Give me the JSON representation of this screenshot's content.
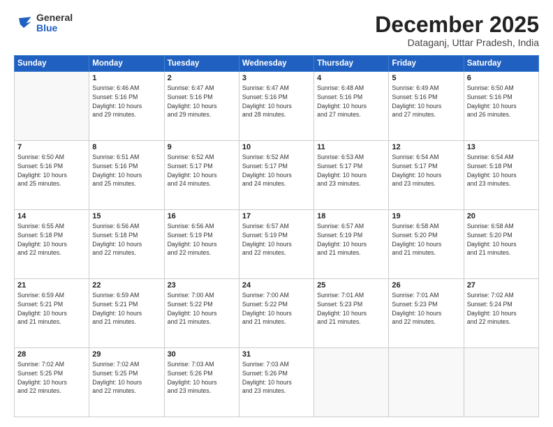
{
  "logo": {
    "general": "General",
    "blue": "Blue"
  },
  "header": {
    "month": "December 2025",
    "location": "Dataganj, Uttar Pradesh, India"
  },
  "weekdays": [
    "Sunday",
    "Monday",
    "Tuesday",
    "Wednesday",
    "Thursday",
    "Friday",
    "Saturday"
  ],
  "weeks": [
    [
      {
        "day": "",
        "info": ""
      },
      {
        "day": "1",
        "info": "Sunrise: 6:46 AM\nSunset: 5:16 PM\nDaylight: 10 hours\nand 29 minutes."
      },
      {
        "day": "2",
        "info": "Sunrise: 6:47 AM\nSunset: 5:16 PM\nDaylight: 10 hours\nand 29 minutes."
      },
      {
        "day": "3",
        "info": "Sunrise: 6:47 AM\nSunset: 5:16 PM\nDaylight: 10 hours\nand 28 minutes."
      },
      {
        "day": "4",
        "info": "Sunrise: 6:48 AM\nSunset: 5:16 PM\nDaylight: 10 hours\nand 27 minutes."
      },
      {
        "day": "5",
        "info": "Sunrise: 6:49 AM\nSunset: 5:16 PM\nDaylight: 10 hours\nand 27 minutes."
      },
      {
        "day": "6",
        "info": "Sunrise: 6:50 AM\nSunset: 5:16 PM\nDaylight: 10 hours\nand 26 minutes."
      }
    ],
    [
      {
        "day": "7",
        "info": "Sunrise: 6:50 AM\nSunset: 5:16 PM\nDaylight: 10 hours\nand 25 minutes."
      },
      {
        "day": "8",
        "info": "Sunrise: 6:51 AM\nSunset: 5:16 PM\nDaylight: 10 hours\nand 25 minutes."
      },
      {
        "day": "9",
        "info": "Sunrise: 6:52 AM\nSunset: 5:17 PM\nDaylight: 10 hours\nand 24 minutes."
      },
      {
        "day": "10",
        "info": "Sunrise: 6:52 AM\nSunset: 5:17 PM\nDaylight: 10 hours\nand 24 minutes."
      },
      {
        "day": "11",
        "info": "Sunrise: 6:53 AM\nSunset: 5:17 PM\nDaylight: 10 hours\nand 23 minutes."
      },
      {
        "day": "12",
        "info": "Sunrise: 6:54 AM\nSunset: 5:17 PM\nDaylight: 10 hours\nand 23 minutes."
      },
      {
        "day": "13",
        "info": "Sunrise: 6:54 AM\nSunset: 5:18 PM\nDaylight: 10 hours\nand 23 minutes."
      }
    ],
    [
      {
        "day": "14",
        "info": "Sunrise: 6:55 AM\nSunset: 5:18 PM\nDaylight: 10 hours\nand 22 minutes."
      },
      {
        "day": "15",
        "info": "Sunrise: 6:56 AM\nSunset: 5:18 PM\nDaylight: 10 hours\nand 22 minutes."
      },
      {
        "day": "16",
        "info": "Sunrise: 6:56 AM\nSunset: 5:19 PM\nDaylight: 10 hours\nand 22 minutes."
      },
      {
        "day": "17",
        "info": "Sunrise: 6:57 AM\nSunset: 5:19 PM\nDaylight: 10 hours\nand 22 minutes."
      },
      {
        "day": "18",
        "info": "Sunrise: 6:57 AM\nSunset: 5:19 PM\nDaylight: 10 hours\nand 21 minutes."
      },
      {
        "day": "19",
        "info": "Sunrise: 6:58 AM\nSunset: 5:20 PM\nDaylight: 10 hours\nand 21 minutes."
      },
      {
        "day": "20",
        "info": "Sunrise: 6:58 AM\nSunset: 5:20 PM\nDaylight: 10 hours\nand 21 minutes."
      }
    ],
    [
      {
        "day": "21",
        "info": "Sunrise: 6:59 AM\nSunset: 5:21 PM\nDaylight: 10 hours\nand 21 minutes."
      },
      {
        "day": "22",
        "info": "Sunrise: 6:59 AM\nSunset: 5:21 PM\nDaylight: 10 hours\nand 21 minutes."
      },
      {
        "day": "23",
        "info": "Sunrise: 7:00 AM\nSunset: 5:22 PM\nDaylight: 10 hours\nand 21 minutes."
      },
      {
        "day": "24",
        "info": "Sunrise: 7:00 AM\nSunset: 5:22 PM\nDaylight: 10 hours\nand 21 minutes."
      },
      {
        "day": "25",
        "info": "Sunrise: 7:01 AM\nSunset: 5:23 PM\nDaylight: 10 hours\nand 21 minutes."
      },
      {
        "day": "26",
        "info": "Sunrise: 7:01 AM\nSunset: 5:23 PM\nDaylight: 10 hours\nand 22 minutes."
      },
      {
        "day": "27",
        "info": "Sunrise: 7:02 AM\nSunset: 5:24 PM\nDaylight: 10 hours\nand 22 minutes."
      }
    ],
    [
      {
        "day": "28",
        "info": "Sunrise: 7:02 AM\nSunset: 5:25 PM\nDaylight: 10 hours\nand 22 minutes."
      },
      {
        "day": "29",
        "info": "Sunrise: 7:02 AM\nSunset: 5:25 PM\nDaylight: 10 hours\nand 22 minutes."
      },
      {
        "day": "30",
        "info": "Sunrise: 7:03 AM\nSunset: 5:26 PM\nDaylight: 10 hours\nand 23 minutes."
      },
      {
        "day": "31",
        "info": "Sunrise: 7:03 AM\nSunset: 5:26 PM\nDaylight: 10 hours\nand 23 minutes."
      },
      {
        "day": "",
        "info": ""
      },
      {
        "day": "",
        "info": ""
      },
      {
        "day": "",
        "info": ""
      }
    ]
  ]
}
